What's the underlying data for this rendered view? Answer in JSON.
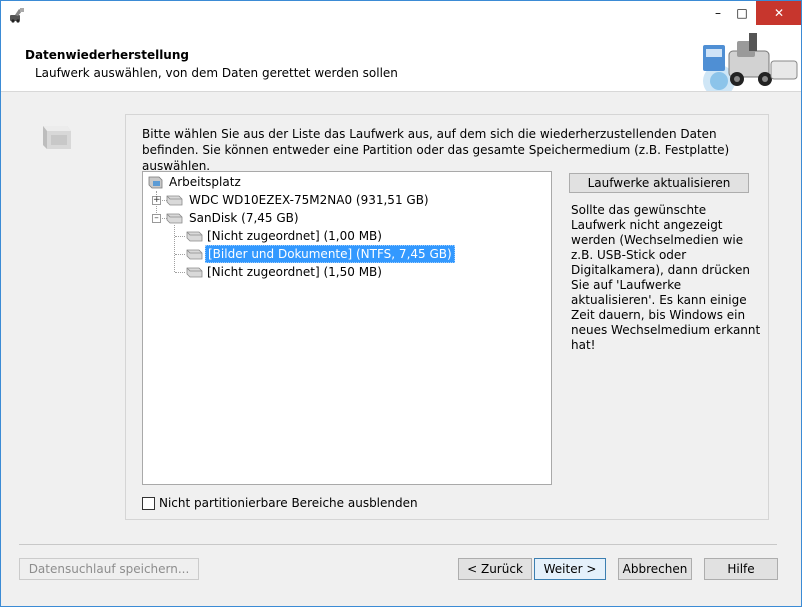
{
  "window": {
    "controls": {
      "minimize": "–",
      "maximize": "□",
      "close": "✕"
    }
  },
  "header": {
    "title": "Datenwiederherstellung",
    "subtitle": "Laufwerk auswählen, von dem Daten gerettet werden sollen"
  },
  "intro": "Bitte wählen Sie aus der Liste das Laufwerk aus, auf dem sich die wiederherzustellenden Daten befinden. Sie können entweder eine Partition oder das gesamte Speichermedium (z.B. Festplatte) auswählen.",
  "tree": {
    "root": "Arbeitsplatz",
    "disks": [
      {
        "label": "WDC WD10EZEX-75M2NA0 (931,51 GB)",
        "expander": "+"
      },
      {
        "label": "SanDisk (7,45 GB)",
        "expander": "–"
      }
    ],
    "partitions": [
      {
        "label": "[Nicht zugeordnet] (1,00 MB)"
      },
      {
        "label": "[Bilder und Dokumente] (NTFS, 7,45 GB)"
      },
      {
        "label": "[Nicht zugeordnet] (1,50 MB)"
      }
    ]
  },
  "refresh_label": "Laufwerke aktualisieren",
  "help_text": "Sollte das gewünschte Laufwerk nicht angezeigt werden (Wechselmedien wie z.B. USB-Stick oder Digitalkamera), dann drücken Sie auf 'Laufwerke aktualisieren'. Es kann einige Zeit dauern, bis Windows ein neues Wechselmedium erkannt hat!",
  "checkbox_label": "Nicht partitionierbare Bereiche ausblenden",
  "footer": {
    "save_scan": "Datensuchlauf speichern...",
    "back": "< Zurück",
    "next": "Weiter >",
    "cancel": "Abbrechen",
    "help": "Hilfe"
  },
  "colors": {
    "selection": "#3399ff",
    "close_button": "#c7362d",
    "window_border": "#3b8bd5"
  }
}
